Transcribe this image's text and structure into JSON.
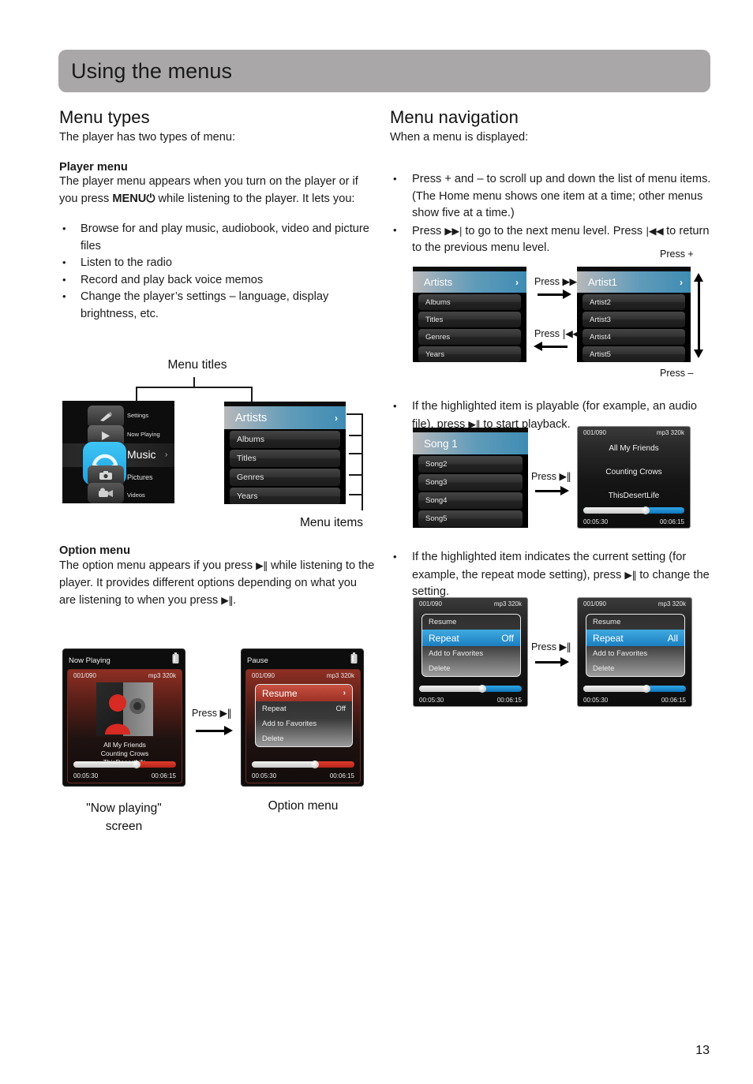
{
  "header": {
    "title": "Using the menus"
  },
  "page": {
    "number": "13"
  },
  "left": {
    "section_title": "Menu types",
    "lead": "The player has two types of menu:",
    "player_menu_heading": "Player menu",
    "player_menu_body_1": "The player menu appears when you turn on the player or if you press ",
    "player_menu_bold": "MENU",
    "player_menu_power_glyph": "⏻",
    "player_menu_body_2": " while listening to the player. It lets you:",
    "bullets": [
      "Browse for and play music, audiobook, video and picture files",
      "Listen to the radio",
      "Record and play back voice memos",
      "Change the player’s settings – language, display brightness, etc."
    ],
    "label_menu_titles": "Menu titles",
    "label_menu_items": "Menu items",
    "home_menu": {
      "items": [
        "Settings",
        "Now Playing",
        "Music",
        "Pictures",
        "Videos"
      ],
      "selected": "Music",
      "selected_chevron": "›"
    },
    "artists_menu": {
      "title": "Artists",
      "chevron": "›",
      "items": [
        "Albums",
        "Titles",
        "Genres",
        "Years"
      ]
    },
    "option_menu_heading": "Option menu",
    "option_menu_body_1": "The option menu appears if you press ",
    "option_menu_playpause": "▶‖",
    "option_menu_body_2": " while listening to the player. It provides different options depending on what you are listening to when you press ",
    "option_menu_body_3": ".",
    "now_playing_screen": {
      "status": "Now Playing",
      "track_index": "001/090",
      "format": "mp3 320k",
      "line1": "All My Friends",
      "line2": "Counting Crows",
      "line3": "ThisDesertLife",
      "elapsed": "00:05:30",
      "total": "00:06:15",
      "battery_icon": "battery-icon"
    },
    "option_screen": {
      "status": "Pause",
      "track_index": "001/090",
      "format": "mp3 320k",
      "items": [
        {
          "label": "Resume",
          "value": "›",
          "selected": true
        },
        {
          "label": "Repeat",
          "value": "Off",
          "selected": false
        },
        {
          "label": "Add to Favorites",
          "value": "",
          "selected": false
        },
        {
          "label": "Delete",
          "value": "",
          "selected": false
        }
      ],
      "elapsed": "00:05:30",
      "total": "00:06:15"
    },
    "press_label_1": "Press",
    "press_glyph_1": "▶‖",
    "caption_now_playing_l1": "\"Now playing\"",
    "caption_now_playing_l2": "screen",
    "caption_option_menu": "Option menu"
  },
  "right": {
    "section_title": "Menu navigation",
    "lead": "When a menu is displayed:",
    "bullet_1": "Press + and – to scroll up and down the list of menu items. (The Home menu shows one item at a time; other menus show five at a time.)",
    "bullet_2_a": "Press ",
    "bullet_2_glyph_next": "▶▶|",
    "bullet_2_b": " to go to the next menu level. Press ",
    "bullet_2_glyph_prev": "|◀◀",
    "bullet_2_c": " to return to the previous menu level.",
    "press_plus": "Press +",
    "press_minus": "Press –",
    "press_next_label": "Press",
    "press_next_glyph": "▶▶|",
    "press_prev_label": "Press",
    "press_prev_glyph": "|◀◀",
    "artists_menu": {
      "title": "Artists",
      "chevron": "›",
      "items": [
        "Albums",
        "Titles",
        "Genres",
        "Years"
      ]
    },
    "artist_menu": {
      "title": "Artist1",
      "chevron": "›",
      "items": [
        "Artist2",
        "Artist3",
        "Artist4",
        "Artist5"
      ]
    },
    "bullet_3_a": "If the highlighted item is playable (for example, an audio file), press ",
    "bullet_3_glyph": "▶‖",
    "bullet_3_b": " to start playback.",
    "song_menu": {
      "title": "Song 1",
      "items": [
        "Song2",
        "Song3",
        "Song4",
        "Song5"
      ]
    },
    "playing_screen": {
      "track_index": "001/090",
      "format": "mp3 320k",
      "line1": "All My Friends",
      "line2": "Counting Crows",
      "line3": "ThisDesertLife",
      "elapsed": "00:05:30",
      "total": "00:06:15"
    },
    "press_play_label": "Press",
    "press_play_glyph": "▶‖",
    "bullet_4_a": "If the highlighted item indicates the current setting (for example, the repeat mode setting), press ",
    "bullet_4_glyph": "▶‖",
    "bullet_4_b": " to change the setting.",
    "repeat_off_screen": {
      "track_index": "001/090",
      "format": "mp3 320k",
      "items": [
        {
          "label": "Resume",
          "value": "",
          "selected": false
        },
        {
          "label": "Repeat",
          "value": "Off",
          "selected": true
        },
        {
          "label": "Add to Favorites",
          "value": "",
          "selected": false
        },
        {
          "label": "Delete",
          "value": "",
          "selected": false
        }
      ],
      "elapsed": "00:05:30",
      "total": "00:06:15"
    },
    "repeat_all_screen": {
      "track_index": "001/090",
      "format": "mp3 320k",
      "items": [
        {
          "label": "Resume",
          "value": "",
          "selected": false
        },
        {
          "label": "Repeat",
          "value": "All",
          "selected": true
        },
        {
          "label": "Add to Favorites",
          "value": "",
          "selected": false
        },
        {
          "label": "Delete",
          "value": "",
          "selected": false
        }
      ],
      "elapsed": "00:05:30",
      "total": "00:06:15"
    },
    "press_repeat_label": "Press",
    "press_repeat_glyph": "▶‖"
  },
  "colors": {
    "header_gray": "#a9a7a8",
    "accent_blue": "#3f8cb4",
    "accent_red": "#b0392c",
    "screen_black": "#0b0b0b"
  }
}
